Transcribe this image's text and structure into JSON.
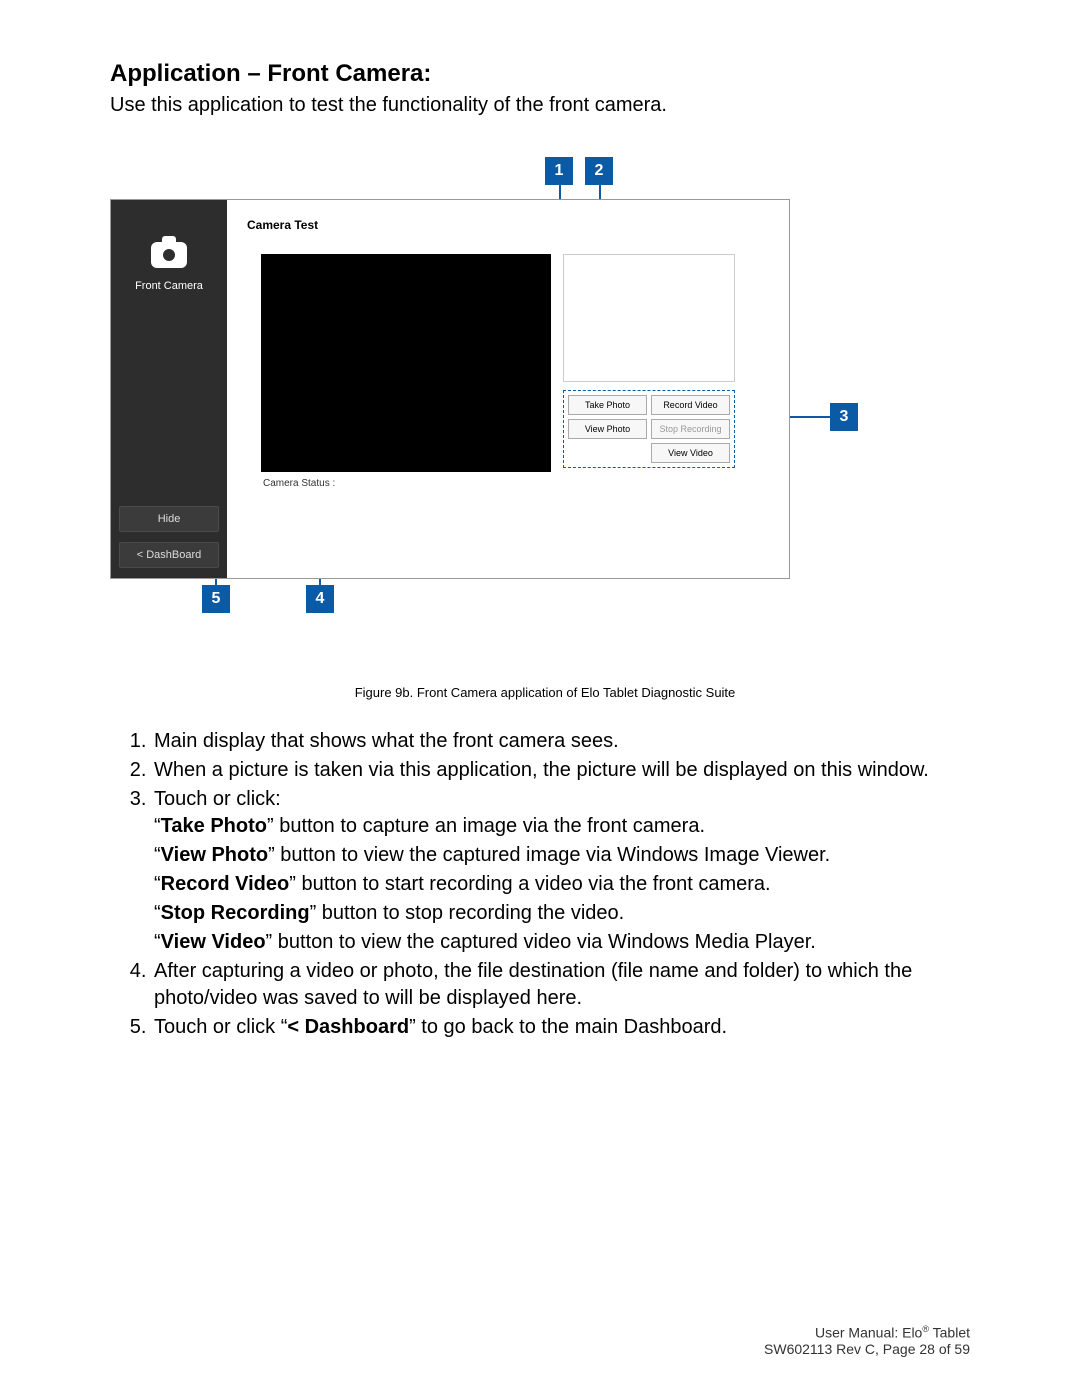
{
  "heading": "Application – Front Camera:",
  "intro": "Use this application to test the functionality of the front camera.",
  "callouts": {
    "c1": "1",
    "c2": "2",
    "c3": "3",
    "c4": "4",
    "c5": "5"
  },
  "app": {
    "cam_label": "Front Camera",
    "hide": "Hide",
    "dashboard": "< DashBoard",
    "title": "Camera Test",
    "status": "Camera Status :",
    "buttons": {
      "take_photo": "Take Photo",
      "record_video": "Record Video",
      "view_photo": "View Photo",
      "stop_recording": "Stop Recording",
      "view_video": "View Video"
    }
  },
  "caption": "Figure 9b. Front Camera application of Elo Tablet Diagnostic Suite",
  "list": {
    "i1": "Main display that shows what the front camera sees.",
    "i2": "When a picture is taken via this application, the picture will be displayed on this window.",
    "i3": "Touch or click:",
    "i3a_pre": "“",
    "i3a_b": "Take Photo",
    "i3a_post": "” button to capture an image via the front camera.",
    "i3b_pre": "“",
    "i3b_b": "View Photo",
    "i3b_post": "” button to view the captured image via Windows Image Viewer.",
    "i3c_pre": "“",
    "i3c_b": "Record Video",
    "i3c_post": "” button to start recording a video via the front camera.",
    "i3d_pre": "“",
    "i3d_b": "Stop Recording",
    "i3d_post": "” button to stop recording the video.",
    "i3e_pre": "“",
    "i3e_b": "View Video",
    "i3e_post": "” button to view the captured video via Windows Media Player.",
    "i4": "After capturing a video or photo, the file destination (file name and folder) to which the photo/video was saved to will be displayed here.",
    "i5_pre": "Touch or click “",
    "i5_b": "< Dashboard",
    "i5_post": "” to go back to the main Dashboard."
  },
  "footer": {
    "line1a": "User Manual: Elo",
    "line1b": " Tablet",
    "line2": "SW602113 Rev C, Page 28 of 59"
  }
}
